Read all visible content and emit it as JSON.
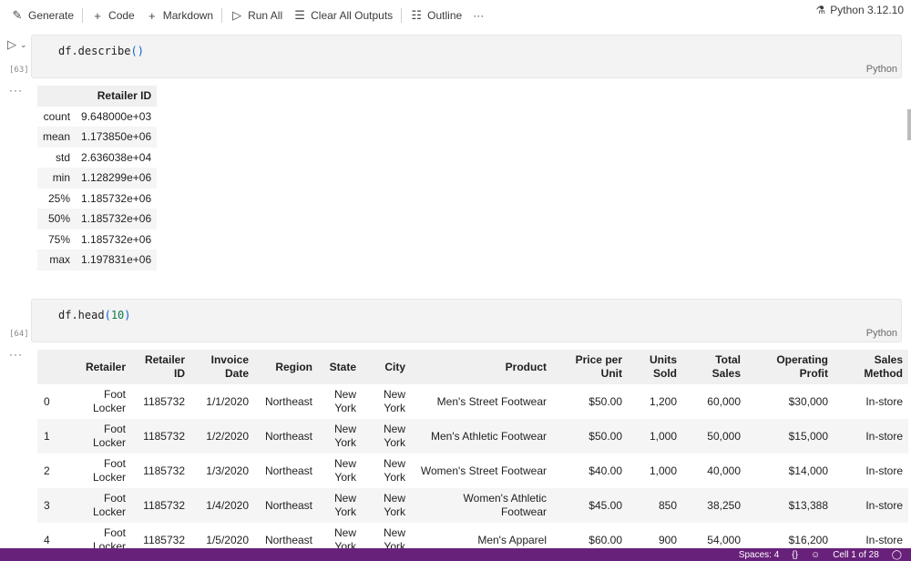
{
  "toolbar": {
    "generate": "Generate",
    "code": "Code",
    "markdown": "Markdown",
    "run_all": "Run All",
    "clear_outputs": "Clear All Outputs",
    "outline": "Outline",
    "more": "···",
    "kernel": "Python 3.12.10"
  },
  "cells": [
    {
      "count": "[63]",
      "code_fn": "df.describe",
      "code_open": "(",
      "code_arg": "",
      "code_close": ")",
      "lang": "Python"
    },
    {
      "count": "[64]",
      "code_fn": "df.head",
      "code_open": "(",
      "code_arg": "10",
      "code_close": ")",
      "lang": "Python"
    }
  ],
  "output_dots": "···",
  "describe": {
    "column": "Retailer ID",
    "rows": [
      {
        "stat": "count",
        "value": "9.648000e+03"
      },
      {
        "stat": "mean",
        "value": "1.173850e+06"
      },
      {
        "stat": "std",
        "value": "2.636038e+04"
      },
      {
        "stat": "min",
        "value": "1.128299e+06"
      },
      {
        "stat": "25%",
        "value": "1.185732e+06"
      },
      {
        "stat": "50%",
        "value": "1.185732e+06"
      },
      {
        "stat": "75%",
        "value": "1.185732e+06"
      },
      {
        "stat": "max",
        "value": "1.197831e+06"
      }
    ]
  },
  "head": {
    "columns": [
      "",
      "Retailer",
      "Retailer ID",
      "Invoice Date",
      "Region",
      "State",
      "City",
      "Product",
      "Price per Unit",
      "Units Sold",
      "Total Sales",
      "Operating Profit",
      "Sales Method"
    ],
    "rows": [
      [
        "0",
        "Foot Locker",
        "1185732",
        "1/1/2020",
        "Northeast",
        "New York",
        "New York",
        "Men's Street Footwear",
        "$50.00",
        "1,200",
        "60,000",
        "$30,000",
        "In-store"
      ],
      [
        "1",
        "Foot Locker",
        "1185732",
        "1/2/2020",
        "Northeast",
        "New York",
        "New York",
        "Men's Athletic Footwear",
        "$50.00",
        "1,000",
        "50,000",
        "$15,000",
        "In-store"
      ],
      [
        "2",
        "Foot Locker",
        "1185732",
        "1/3/2020",
        "Northeast",
        "New York",
        "New York",
        "Women's Street Footwear",
        "$40.00",
        "1,000",
        "40,000",
        "$14,000",
        "In-store"
      ],
      [
        "3",
        "Foot Locker",
        "1185732",
        "1/4/2020",
        "Northeast",
        "New York",
        "New York",
        "Women's Athletic Footwear",
        "$45.00",
        "850",
        "38,250",
        "$13,388",
        "In-store"
      ],
      [
        "4",
        "Foot Locker",
        "1185732",
        "1/5/2020",
        "Northeast",
        "New York",
        "New York",
        "Men's Apparel",
        "$60.00",
        "900",
        "54,000",
        "$16,200",
        "In-store"
      ]
    ]
  },
  "status": {
    "spaces": "Spaces: 4",
    "braces": "{}",
    "cell": "Cell 1 of 28"
  },
  "colors": {
    "statusbar": "#68217a",
    "cell_bg": "#f3f3f3",
    "table_header": "#f0f0f0"
  }
}
